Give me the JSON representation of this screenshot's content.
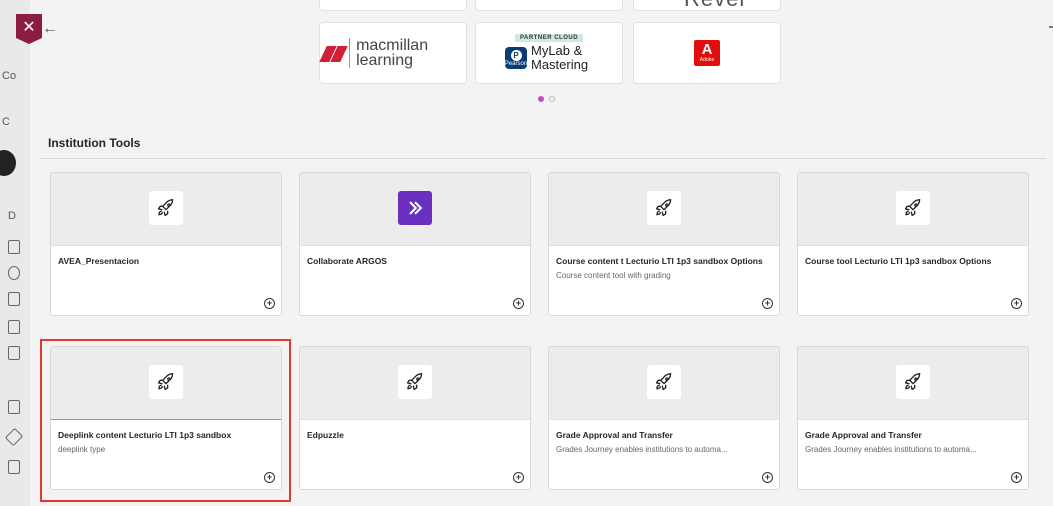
{
  "window": {
    "close_glyph": "✕",
    "back_glyph": "←"
  },
  "background_fragments": [
    "Co",
    "C",
    "D"
  ],
  "carousel": {
    "top_partner_text": "Revel",
    "partners": [
      {
        "name": "macmillan-learning",
        "text": "macmillan learning"
      },
      {
        "name": "mylab-mastering",
        "badge": "PARTNER CLOUD",
        "logo_text": "Pearson",
        "text": "MyLab & Mastering"
      },
      {
        "name": "adobe",
        "logo_letter": "A",
        "logo_word": "Adobe"
      }
    ],
    "page_count": 2,
    "active_page": 1
  },
  "section": {
    "title": "Institution Tools"
  },
  "icons": {
    "tool_icon": "rocket-icon",
    "add_icon": "plus-circle-icon",
    "collab_icon": "chevron-right-icon"
  },
  "colors": {
    "close_bg": "#8c1d40",
    "highlight": "#e53a2f",
    "carousel_active": "#c44ac4",
    "collab_logo": "#6b2fbf"
  },
  "tools": [
    {
      "title": "AVEA_Presentacion",
      "description": ""
    },
    {
      "title": "Collaborate ARGOS",
      "description": ""
    },
    {
      "title": "Course content t Lecturio LTI 1p3 sandbox Options",
      "description": "Course content tool with grading"
    },
    {
      "title": "Course tool Lecturio LTI 1p3 sandbox Options",
      "description": ""
    },
    {
      "title": "Deeplink content Lecturio LTI 1p3 sandbox",
      "description": "deeplink type"
    },
    {
      "title": "Edpuzzle",
      "description": ""
    },
    {
      "title": "Grade Approval and Transfer",
      "description": "Grades Journey enables institutions to automa..."
    },
    {
      "title": "Grade Approval and Transfer",
      "description": "Grades Journey enables institutions to automa..."
    }
  ],
  "add_glyph": "+"
}
